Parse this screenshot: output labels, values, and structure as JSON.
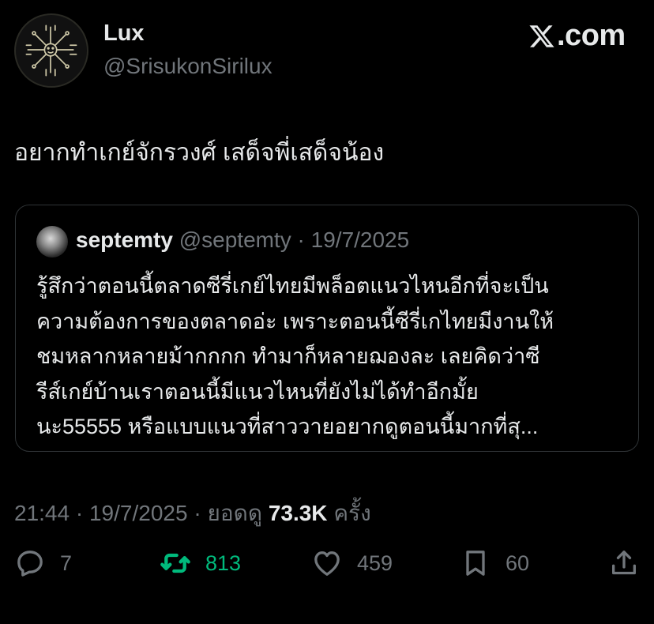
{
  "author": {
    "name": "Lux",
    "handle": "@SrisukonSirilux"
  },
  "brand": {
    "logo_text": ".com",
    "logo_icon": "x-logo-icon"
  },
  "post": {
    "text": "อยากทำเกย์จักรวงศ์ เสด็จพี่เสด็จน้อง"
  },
  "quote": {
    "name": "septemty",
    "handle": "@septemty",
    "separator": " · ",
    "date": "19/7/2025",
    "body": "รู้สึกว่าตอนนี้ตลาดซีรี่เกย์ไทยมีพล็อตแนวไหนอีกที่จะเป็น\nความต้องการของตลาดอ่ะ เพราะตอนนี้ซีรี่เกไทยมีงานให้\nชมหลากหลายม้ากกกก ทำมาก็หลายฌองละ เลยคิดว่าซี\nรีส์เกย์บ้านเราตอนนี้มีแนวไหนที่ยังไม่ได้ทำอีกมั้ย\nนะ55555 หรือแบบแนวที่สาววายอยากดูตอนนี้มากที่สุ..."
  },
  "meta": {
    "time": "21:44",
    "sep1": " · ",
    "date": "19/7/2025",
    "sep2": " · ",
    "views_label": "ยอดดู",
    "views": "73.3K",
    "views_suffix": "ครั้ง"
  },
  "actions": {
    "replies": "7",
    "reposts": "813",
    "likes": "459",
    "bookmarks": "60"
  },
  "colors": {
    "background": "#000000",
    "text": "#e7e9ea",
    "muted": "#71767b",
    "repost_active": "#00ba7c",
    "border": "#2f3336"
  }
}
